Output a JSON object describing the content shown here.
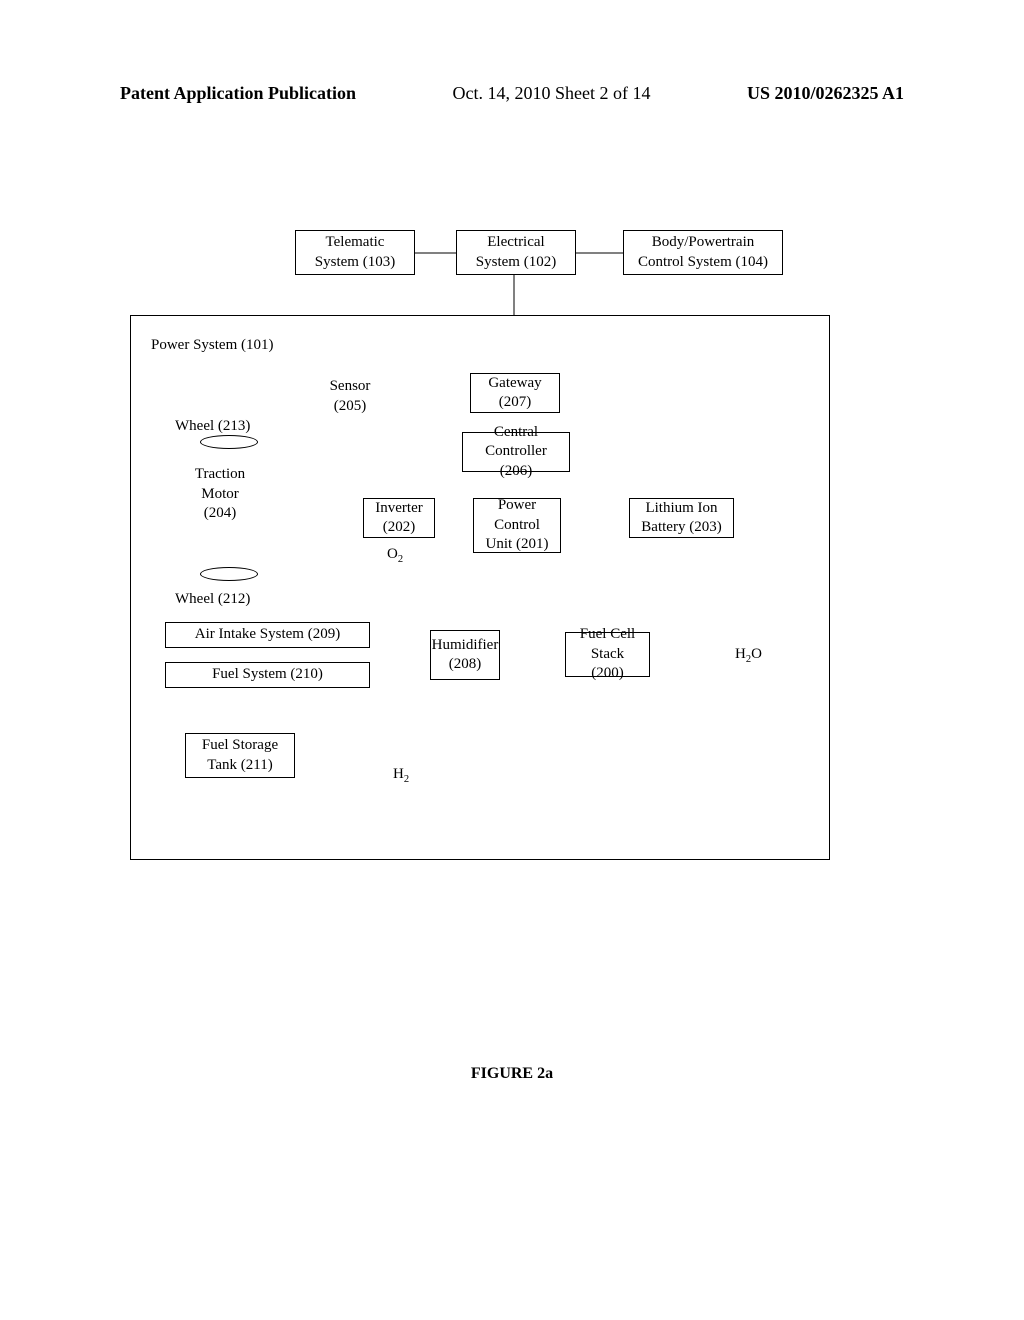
{
  "header": {
    "left": "Patent Application Publication",
    "center": "Oct. 14, 2010  Sheet 2 of 14",
    "right": "US 2010/0262325 A1"
  },
  "caption": "FIGURE 2a",
  "boxes": {
    "telematic": "Telematic\nSystem (103)",
    "electrical": "Electrical\nSystem (102)",
    "bodypowertrain": "Body/Powertrain\nControl System (104)",
    "powersystem_label": "Power System (101)",
    "sensor": "Sensor\n(205)",
    "gateway": "Gateway\n(207)",
    "wheel213": "Wheel (213)",
    "centralcontroller": "Central\nController (206)",
    "tractionmotor": "Traction\nMotor\n(204)",
    "inverter": "Inverter\n(202)",
    "powercontrol": "Power\nControl\nUnit (201)",
    "lithium": "Lithium Ion\nBattery (203)",
    "wheel212": "Wheel (212)",
    "airintake": "Air Intake System (209)",
    "humidifier": "Humidifier\n(208)",
    "fuelcell": "Fuel Cell\nStack (200)",
    "fuelsystem": "Fuel System (210)",
    "fuelstorage": "Fuel Storage\nTank (211)",
    "o2": "O",
    "h2": "H",
    "h2o": "H",
    "h2o_suffix": "O"
  }
}
